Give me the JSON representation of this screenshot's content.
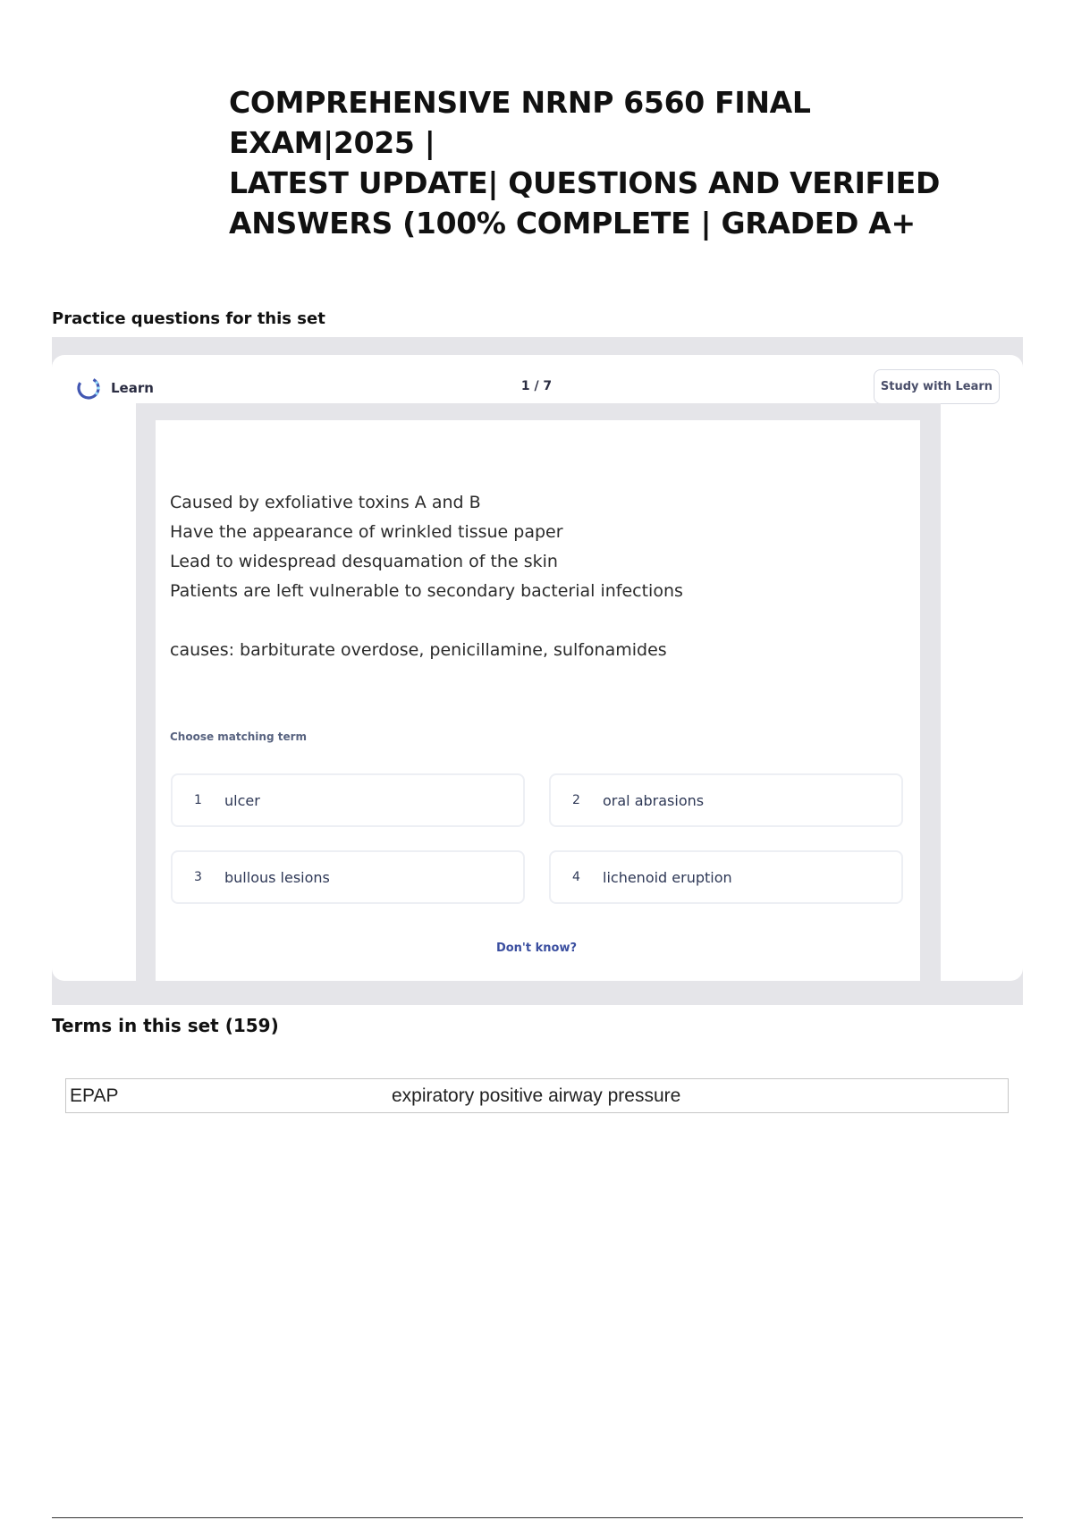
{
  "document": {
    "title": "COMPREHENSIVE NRNP 6560 FINAL EXAM|2025 | LATEST UPDATE| QUESTIONS AND VERIFIED ANSWERS (100% COMPLETE | GRADED A+",
    "title_lines": [
      "COMPREHENSIVE NRNP 6560 FINAL EXAM|2025 |",
      "LATEST UPDATE| QUESTIONS AND VERIFIED",
      "ANSWERS (100% COMPLETE | GRADED A+"
    ]
  },
  "practice": {
    "heading": "Practice questions for this set",
    "learn_label": "Learn",
    "learn_icon": "learn-progress-icon",
    "progress": "1 / 7",
    "study_button": "Study with Learn",
    "prompt_lines": [
      "Caused by exfoliative toxins A and B",
      "Have the appearance of wrinkled tissue paper",
      "Lead to widespread desquamation of the skin",
      "Patients are left vulnerable to secondary bacterial infections"
    ],
    "prompt_causes": "causes: barbiturate overdose, penicillamine, sulfonamides",
    "choose_label": "Choose matching term",
    "options": [
      {
        "num": "1",
        "text": "ulcer"
      },
      {
        "num": "2",
        "text": "oral abrasions"
      },
      {
        "num": "3",
        "text": "bullous lesions"
      },
      {
        "num": "4",
        "text": "lichenoid eruption"
      }
    ],
    "dont_know": "Don't know?"
  },
  "terms": {
    "heading": "Terms in this set (159)",
    "rows": [
      {
        "term": "EPAP",
        "definition": "expiratory positive airway pressure"
      }
    ]
  }
}
